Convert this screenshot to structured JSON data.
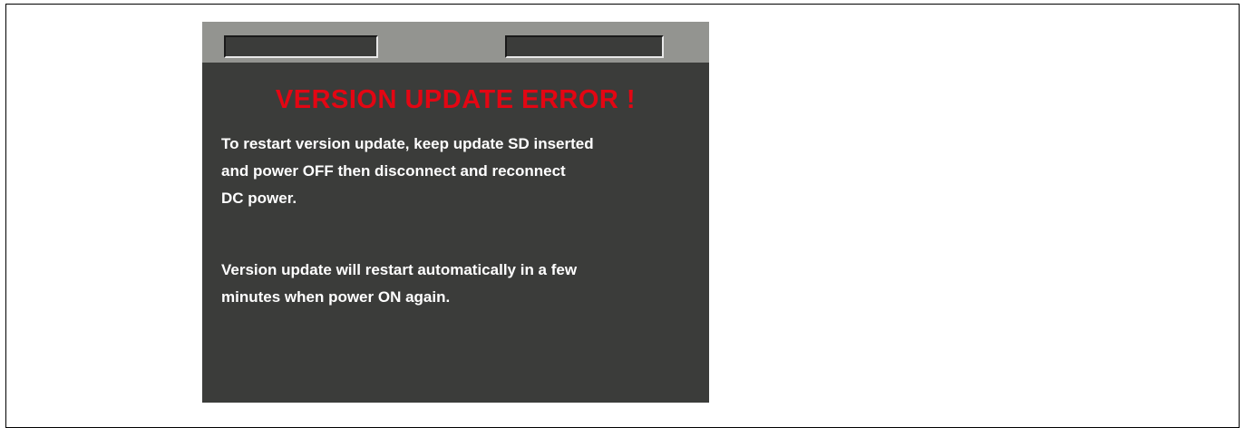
{
  "dialog": {
    "title": "VERSION UPDATE ERROR !",
    "title_color": "#e30613",
    "paragraph1": [
      "To restart version update, keep update SD inserted",
      "and power OFF then disconnect and reconnect",
      "DC power."
    ],
    "paragraph2": [
      "Version update will restart automatically in a few",
      "minutes when power ON again."
    ]
  },
  "colors": {
    "screen_background": "#3b3c3a",
    "top_bar": "#939490",
    "text": "#ffffff"
  }
}
